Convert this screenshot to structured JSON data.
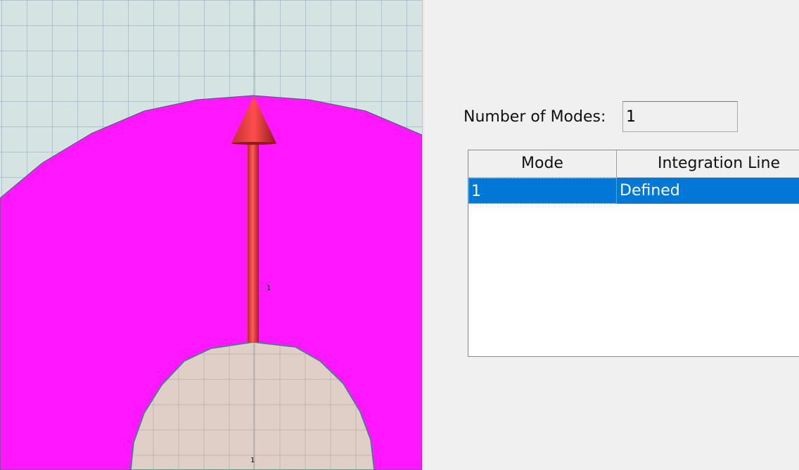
{
  "viewport": {
    "colors": {
      "background": "#d5e3e3",
      "grid": "#9aaab4",
      "port_face": "#ff18ff",
      "inner_conductor": "#e0cfc6",
      "arrow": "#e84646"
    },
    "arrow_label": "1",
    "port_label": "1"
  },
  "panel": {
    "number_of_modes_label": "Number of Modes:",
    "number_of_modes_value": "1",
    "table": {
      "headers": [
        "Mode",
        "Integration Line"
      ],
      "rows": [
        {
          "mode": "1",
          "integration_line": "Defined",
          "selected": true
        }
      ]
    }
  }
}
